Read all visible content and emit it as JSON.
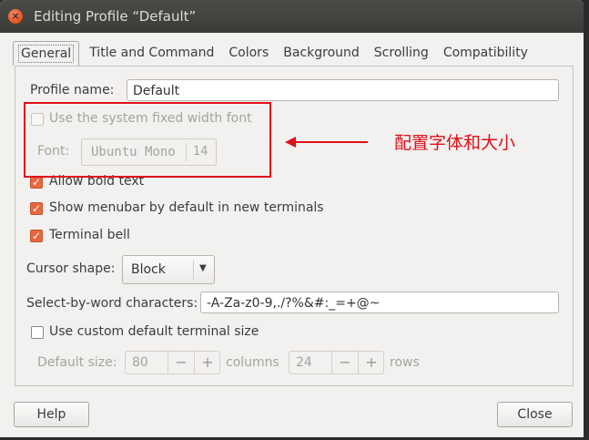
{
  "window": {
    "title": "Editing Profile “Default”",
    "close_glyph": "×"
  },
  "tabs": [
    {
      "label": "General",
      "active": true
    },
    {
      "label": "Title and Command"
    },
    {
      "label": "Colors"
    },
    {
      "label": "Background"
    },
    {
      "label": "Scrolling"
    },
    {
      "label": "Compatibility"
    }
  ],
  "general": {
    "profile_name_label": "Profile name:",
    "profile_name_value": "Default",
    "use_system_font_label": "Use the system fixed width font",
    "use_system_font_checked": false,
    "font_label": "Font:",
    "font_name": "Ubuntu Mono",
    "font_size": "14",
    "allow_bold_label": "Allow bold text",
    "allow_bold_checked": true,
    "show_menubar_label": "Show menubar by default in new terminals",
    "show_menubar_checked": true,
    "terminal_bell_label": "Terminal bell",
    "terminal_bell_checked": true,
    "cursor_shape_label": "Cursor shape:",
    "cursor_shape_value": "Block",
    "select_by_word_label": "Select-by-word characters:",
    "select_by_word_value": "-A-Za-z0-9,./?%&#:_=+@~",
    "custom_size_label": "Use custom default terminal size",
    "custom_size_checked": false,
    "default_size_label": "Default size:",
    "columns_value": "80",
    "columns_label": "columns",
    "rows_value": "24",
    "rows_label": "rows",
    "minus_glyph": "−",
    "plus_glyph": "+"
  },
  "annotation": {
    "text": "配置字体和大小",
    "color": "#e0101a"
  },
  "footer": {
    "help_label": "Help",
    "close_label": "Close"
  },
  "colors": {
    "accent": "#e9673f",
    "titlebar": "#3c3b37"
  }
}
